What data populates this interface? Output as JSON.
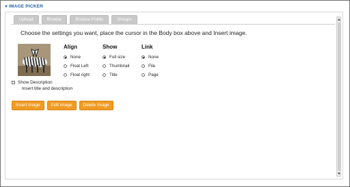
{
  "header": {
    "title": "IMAGE PICKER"
  },
  "tabs": [
    {
      "label": "Upload"
    },
    {
      "label": "Browse"
    },
    {
      "label": "Browse Public"
    },
    {
      "label": "Groups"
    }
  ],
  "instructions": "Choose the settings you want, place the cursor in the Body box above and Insert image.",
  "image": {
    "description": "zebras"
  },
  "align": {
    "heading": "Align",
    "options": [
      {
        "label": "None",
        "selected": true
      },
      {
        "label": "Float Left",
        "selected": false
      },
      {
        "label": "Float right",
        "selected": false
      }
    ]
  },
  "show": {
    "heading": "Show",
    "options": [
      {
        "label": "Full size",
        "selected": true
      },
      {
        "label": "Thumbnail",
        "selected": false
      },
      {
        "label": "Title",
        "selected": false
      }
    ]
  },
  "link": {
    "heading": "Link",
    "options": [
      {
        "label": "None",
        "selected": true
      },
      {
        "label": "File",
        "selected": false
      },
      {
        "label": "Page",
        "selected": false
      }
    ]
  },
  "description": {
    "checkbox_label": "Show Description",
    "checked": false,
    "sub_label": "Insert title and description"
  },
  "buttons": {
    "insert": "Insert image",
    "edit": "Edit image",
    "delete": "Delete image"
  },
  "colors": {
    "accent": "#1f5fa8",
    "button": "#f09b23",
    "tab_disabled": "#c9c9c9"
  }
}
